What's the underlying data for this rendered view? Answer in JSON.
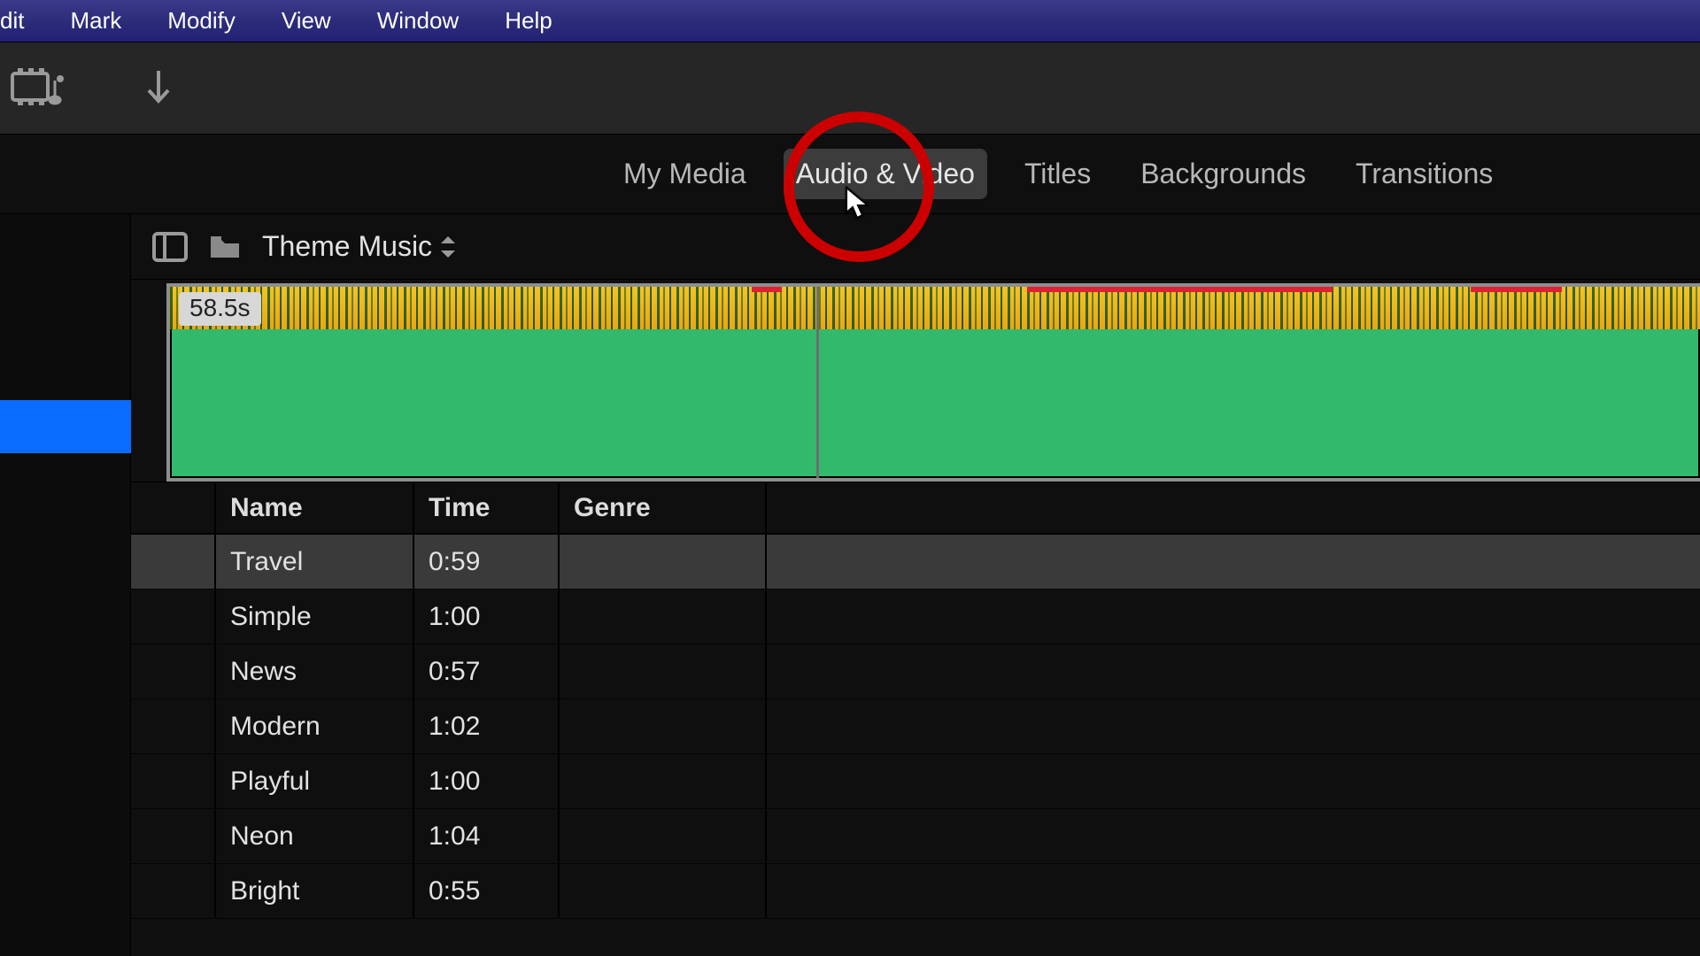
{
  "menubar": {
    "items": [
      "dit",
      "Mark",
      "Modify",
      "View",
      "Window",
      "Help"
    ]
  },
  "tabs": {
    "items": [
      "My Media",
      "Audio & Video",
      "Titles",
      "Backgrounds",
      "Transitions"
    ],
    "active_index": 1
  },
  "folder": {
    "label": "Theme Music"
  },
  "waveform": {
    "time_label": "58.5s"
  },
  "table": {
    "columns": [
      "Name",
      "Time",
      "Genre"
    ],
    "rows": [
      {
        "name": "Travel",
        "time": "0:59",
        "genre": ""
      },
      {
        "name": "Simple",
        "time": "1:00",
        "genre": ""
      },
      {
        "name": "News",
        "time": "0:57",
        "genre": ""
      },
      {
        "name": "Modern",
        "time": "1:02",
        "genre": ""
      },
      {
        "name": "Playful",
        "time": "1:00",
        "genre": ""
      },
      {
        "name": "Neon",
        "time": "1:04",
        "genre": ""
      },
      {
        "name": "Bright",
        "time": "0:55",
        "genre": ""
      }
    ],
    "selected_index": 0
  }
}
